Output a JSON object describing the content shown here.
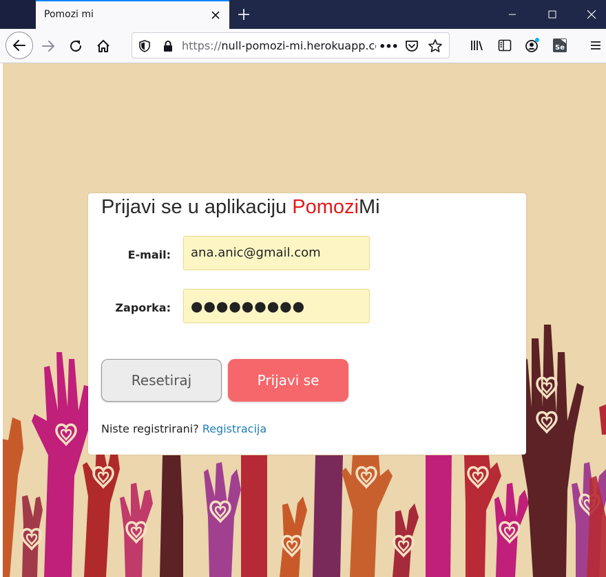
{
  "browser": {
    "tab_title": "Pomozi mi",
    "url_scheme": "https://",
    "url_host": "null-pomozi-mi.herokuapp.co",
    "page_actions_label": "•••"
  },
  "form": {
    "title_prefix": "Prijavi se u aplikaciju ",
    "brand_red": "Pomozi",
    "brand_rest": "Mi",
    "email_label": "E-mail:",
    "email_value": "ana.anic@gmail.com",
    "password_label": "Zaporka:",
    "password_value": "●●●●●●●●●",
    "reset_label": "Resetiraj",
    "login_label": "Prijavi se",
    "register_prompt": "Niste registrirani? ",
    "register_link": "Registracija"
  },
  "colors": {
    "page_background": "#ebd6ad",
    "brand_red": "#e31919",
    "login_button": "#f5676a",
    "input_background": "#fdf6c4",
    "link": "#1e7eb8"
  }
}
